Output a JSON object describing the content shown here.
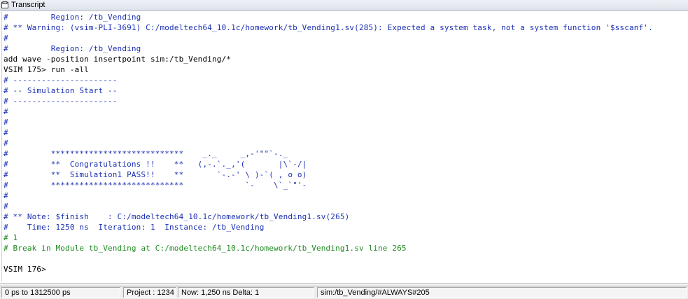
{
  "window": {
    "title": "Transcript"
  },
  "transcript": {
    "lines": [
      {
        "text": "#         Region: /tb_Vending",
        "style": "comment"
      },
      {
        "text": "# ** Warning: (vsim-PLI-3691) C:/modeltech64_10.1c/homework/tb_Vending1.sv(285): Expected a system task, not a system function '$sscanf'.",
        "style": "comment"
      },
      {
        "text": "#",
        "style": "comment"
      },
      {
        "text": "#         Region: /tb_Vending",
        "style": "comment"
      },
      {
        "text": "add wave -position insertpoint sim:/tb_Vending/*",
        "style": "cmd"
      },
      {
        "text": "VSIM 175> run -all",
        "style": "prompt"
      },
      {
        "text": "# ----------------------",
        "style": "comment"
      },
      {
        "text": "# -- Simulation Start --",
        "style": "comment"
      },
      {
        "text": "# ----------------------",
        "style": "comment"
      },
      {
        "text": "#",
        "style": "comment"
      },
      {
        "text": "#",
        "style": "comment"
      },
      {
        "text": "#",
        "style": "comment"
      },
      {
        "text": "#",
        "style": "comment"
      },
      {
        "text": "#         ****************************    _._     _,-'\"\"`-._",
        "style": "comment"
      },
      {
        "text": "#         **  Congratulations !!    **   (,-.`._,'(       |\\`-/|",
        "style": "comment"
      },
      {
        "text": "#         **  Simulation1 PASS!!    **       `-.-' \\ )-`( , o o)",
        "style": "comment"
      },
      {
        "text": "#         ****************************             `-    \\`_`\"'-",
        "style": "comment"
      },
      {
        "text": "#",
        "style": "comment"
      },
      {
        "text": "#",
        "style": "comment"
      },
      {
        "text": "# ** Note: $finish    : C:/modeltech64_10.1c/homework/tb_Vending1.sv(265)",
        "style": "comment"
      },
      {
        "text": "#    Time: 1250 ns  Iteration: 1  Instance: /tb_Vending",
        "style": "comment"
      },
      {
        "text": "# 1",
        "style": "green"
      },
      {
        "text": "# Break in Module tb_Vending at C:/modeltech64_10.1c/homework/tb_Vending1.sv line 265",
        "style": "green"
      },
      {
        "text": "",
        "style": "cmd"
      },
      {
        "text": "VSIM 176>",
        "style": "prompt"
      }
    ]
  },
  "status": {
    "range": "0 ps to 1312500 ps",
    "project": "Project : 1234",
    "now": "Now: 1,250 ns  Delta: 1",
    "context": "sim:/tb_Vending/#ALWAYS#205"
  },
  "colors": {
    "comment": "#1b30b4",
    "green": "#1e8b1e",
    "text": "#000000"
  },
  "icons": {
    "tab": "transcript-tab-icon"
  }
}
